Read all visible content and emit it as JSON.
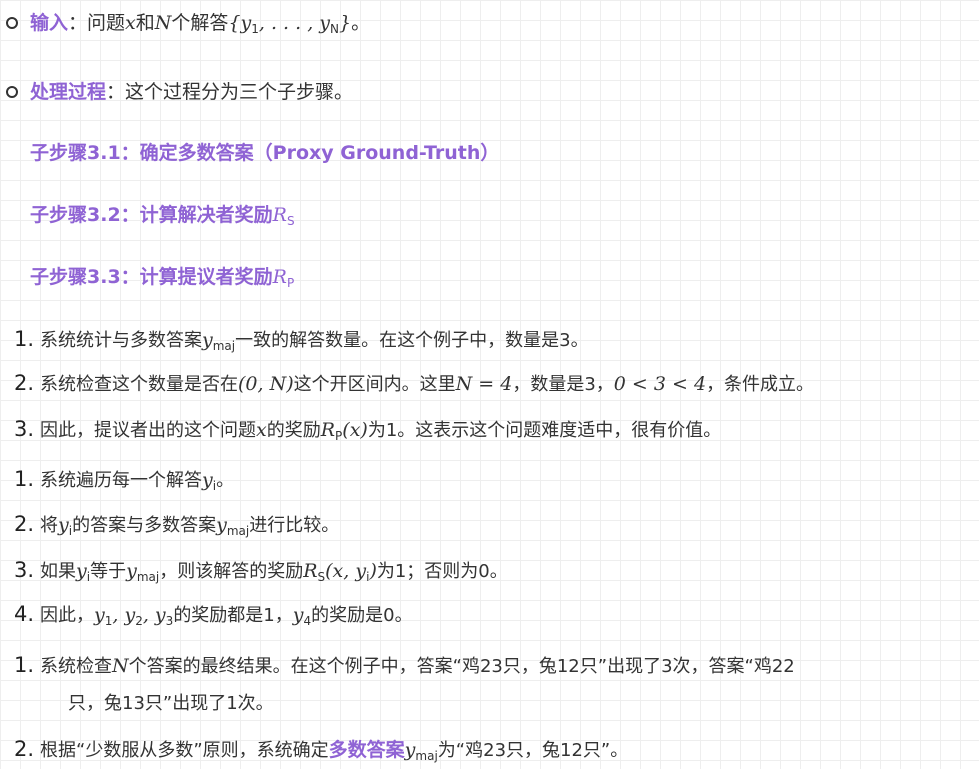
{
  "top_items": [
    {
      "label": "输入",
      "text_parts": [
        "：问题",
        "x",
        "和",
        "N",
        "个解答",
        "{y",
        "1",
        ", . . . , y",
        "N",
        "}",
        "。"
      ]
    },
    {
      "label": "处理过程",
      "text": "：这个过程分为三个子步骤。"
    }
  ],
  "substeps": [
    {
      "label": "子步骤3.1：确定多数答案（Proxy Ground-Truth）"
    },
    {
      "label": "子步骤3.2：计算解决者奖励",
      "math": "R",
      "math_sub": "S"
    },
    {
      "label": "子步骤3.3：计算提议者奖励",
      "math": "R",
      "math_sub": "P"
    }
  ],
  "list_a": [
    {
      "num": "1.",
      "parts": [
        "系统统计与多数答案",
        "y",
        "maj",
        "一致的解答数量。在这个例子中，数量是3。"
      ]
    },
    {
      "num": "2.",
      "parts": [
        "系统检查这个数量是否在",
        "(0, N)",
        "这个开区间内。这里",
        "N = 4",
        "，数量是3，",
        "0 < 3 < 4",
        "，条件成立。"
      ]
    },
    {
      "num": "3.",
      "parts": [
        "因此，提议者出的这个问题",
        "x",
        "的奖励",
        "R",
        "P",
        "(x)",
        "为1。这表示这个问题难度适中，很有价值。"
      ]
    }
  ],
  "list_b": [
    {
      "num": "1.",
      "parts": [
        "系统遍历每一个解答",
        "y",
        "i",
        "。"
      ]
    },
    {
      "num": "2.",
      "parts": [
        "将",
        "y",
        "i",
        "的答案与多数答案",
        "y",
        "maj",
        "进行比较。"
      ]
    },
    {
      "num": "3.",
      "parts": [
        "如果",
        "y",
        "i",
        "等于",
        "y",
        "maj",
        "，则该解答的奖励",
        "R",
        "S",
        "(x, y",
        "i",
        ")",
        "为1；否则为0。"
      ]
    },
    {
      "num": "4.",
      "parts": [
        "因此，",
        "y",
        "1",
        ", y",
        "2",
        ", y",
        "3",
        "的奖励都是1，",
        "y",
        "4",
        "的奖励是0。"
      ]
    }
  ],
  "list_c": [
    {
      "num": "1.",
      "line1_parts": [
        "系统检查",
        "N",
        "个答案的最终结果。在这个例子中，答案“鸡23只，兔12只”出现了3次，答案“鸡22"
      ],
      "line2": "只，兔13只”出现了1次。"
    },
    {
      "num": "2.",
      "parts": [
        "根据“少数服从多数”原则，系统确定",
        "多数答案",
        "y",
        "maj",
        "为“鸡23只，兔12只”。"
      ]
    }
  ]
}
